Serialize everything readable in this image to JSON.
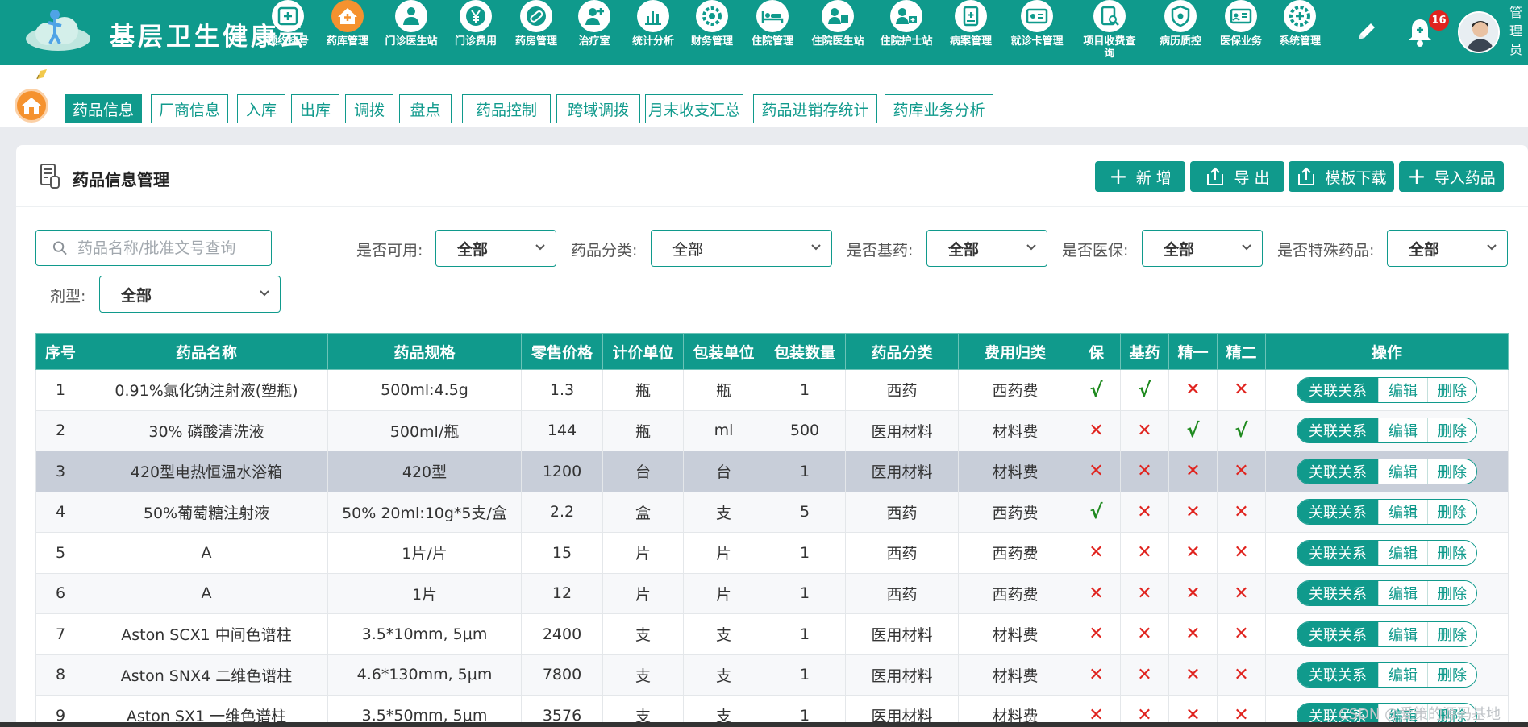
{
  "app": {
    "title": "基层卫生健康云",
    "user_name": "管理员",
    "notification_count": "16"
  },
  "nav_items": [
    {
      "label": "预约挂号",
      "icon": "calendar-plus-icon"
    },
    {
      "label": "药库管理",
      "icon": "pharmacy-house-icon",
      "active": true
    },
    {
      "label": "门诊医生站",
      "icon": "doctor-icon"
    },
    {
      "label": "门诊费用",
      "icon": "yen-coin-icon"
    },
    {
      "label": "药房管理",
      "icon": "pill-icon"
    },
    {
      "label": "治疗室",
      "icon": "nurse-icon"
    },
    {
      "label": "统计分析",
      "icon": "bar-chart-icon"
    },
    {
      "label": "财务管理",
      "icon": "gear-money-icon"
    },
    {
      "label": "住院管理",
      "icon": "hospital-bed-icon"
    },
    {
      "label": "住院医生站",
      "icon": "doctor-card-icon"
    },
    {
      "label": "住院护士站",
      "icon": "nurse-station-icon"
    },
    {
      "label": "病案管理",
      "icon": "medical-record-icon"
    },
    {
      "label": "就诊卡管理",
      "icon": "id-card-icon"
    },
    {
      "label": "项目收费查询",
      "icon": "fee-search-icon"
    },
    {
      "label": "病历质控",
      "icon": "shield-document-icon"
    },
    {
      "label": "医保业务",
      "icon": "insurance-card-icon"
    },
    {
      "label": "系统管理",
      "icon": "settings-plus-icon"
    }
  ],
  "tabs": [
    "药品信息",
    "厂商信息",
    "入库",
    "出库",
    "调拨",
    "盘点",
    "药品控制",
    "跨域调拨",
    "月末收支汇总",
    "药品进销存统计",
    "药库业务分析"
  ],
  "page": {
    "title": "药品信息管理"
  },
  "toolbar": {
    "add": "新 增",
    "export": "导 出",
    "template": "模板下载",
    "import": "导入药品"
  },
  "search": {
    "placeholder": "药品名称/批准文号查询"
  },
  "filters": {
    "available": {
      "label": "是否可用:",
      "value": "全部"
    },
    "category": {
      "label": "药品分类:",
      "value": "全部"
    },
    "essential": {
      "label": "是否基药:",
      "value": "全部"
    },
    "insurance": {
      "label": "是否医保:",
      "value": "全部"
    },
    "special": {
      "label": "是否特殊药品:",
      "value": "全部"
    },
    "dosage": {
      "label": "剂型:",
      "value": "全部"
    }
  },
  "table": {
    "headers": [
      "序号",
      "药品名称",
      "药品规格",
      "零售价格",
      "计价单位",
      "包装单位",
      "包装数量",
      "药品分类",
      "费用归类",
      "保",
      "基药",
      "精一",
      "精二",
      "操作"
    ],
    "row_actions": [
      "关联关系",
      "编辑",
      "删除"
    ],
    "rows": [
      {
        "no": "1",
        "name": "0.91%氯化钠注射液(塑瓶)",
        "spec": "500ml:4.5g",
        "price": "1.3",
        "unit": "瓶",
        "pack_unit": "瓶",
        "pack_qty": "1",
        "category": "西药",
        "fee": "西药费",
        "bao": true,
        "jiyao": true,
        "jing1": false,
        "jing2": false
      },
      {
        "no": "2",
        "name": "30% 磷酸清洗液",
        "spec": "500ml/瓶",
        "price": "144",
        "unit": "瓶",
        "pack_unit": "ml",
        "pack_qty": "500",
        "category": "医用材料",
        "fee": "材料费",
        "bao": false,
        "jiyao": false,
        "jing1": true,
        "jing2": true
      },
      {
        "no": "3",
        "name": "420型电热恒温水浴箱",
        "spec": "420型",
        "price": "1200",
        "unit": "台",
        "pack_unit": "台",
        "pack_qty": "1",
        "category": "医用材料",
        "fee": "材料费",
        "bao": false,
        "jiyao": false,
        "jing1": false,
        "jing2": false
      },
      {
        "no": "4",
        "name": "50%葡萄糖注射液",
        "spec": "50% 20ml:10g*5支/盒",
        "price": "2.2",
        "unit": "盒",
        "pack_unit": "支",
        "pack_qty": "5",
        "category": "西药",
        "fee": "西药费",
        "bao": true,
        "jiyao": false,
        "jing1": false,
        "jing2": false
      },
      {
        "no": "5",
        "name": "A",
        "spec": "1片/片",
        "price": "15",
        "unit": "片",
        "pack_unit": "片",
        "pack_qty": "1",
        "category": "西药",
        "fee": "西药费",
        "bao": false,
        "jiyao": false,
        "jing1": false,
        "jing2": false
      },
      {
        "no": "6",
        "name": "A",
        "spec": "1片",
        "price": "12",
        "unit": "片",
        "pack_unit": "片",
        "pack_qty": "1",
        "category": "西药",
        "fee": "西药费",
        "bao": false,
        "jiyao": false,
        "jing1": false,
        "jing2": false
      },
      {
        "no": "7",
        "name": "Aston SCX1 中间色谱柱",
        "spec": "3.5*10mm, 5μm",
        "price": "2400",
        "unit": "支",
        "pack_unit": "支",
        "pack_qty": "1",
        "category": "医用材料",
        "fee": "材料费",
        "bao": false,
        "jiyao": false,
        "jing1": false,
        "jing2": false
      },
      {
        "no": "8",
        "name": "Aston SNX4 二维色谱柱",
        "spec": "4.6*130mm, 5μm",
        "price": "7800",
        "unit": "支",
        "pack_unit": "支",
        "pack_qty": "1",
        "category": "医用材料",
        "fee": "材料费",
        "bao": false,
        "jiyao": false,
        "jing1": false,
        "jing2": false
      },
      {
        "no": "9",
        "name": "Aston SX1 一维色谱柱",
        "spec": "3.5*50mm, 5μm",
        "price": "3576",
        "unit": "支",
        "pack_unit": "支",
        "pack_qty": "1",
        "category": "医用材料",
        "fee": "材料费",
        "bao": false,
        "jiyao": false,
        "jing1": false,
        "jing2": false
      }
    ],
    "check_mark": "√",
    "cross_mark": "✕",
    "highlighted_row": 3
  },
  "watermark": "CSDN @爱策的源码基地",
  "colors": {
    "primary": "#109a8c",
    "accent": "#f5922f",
    "danger": "#e0241f",
    "success": "#1f8a1f"
  }
}
